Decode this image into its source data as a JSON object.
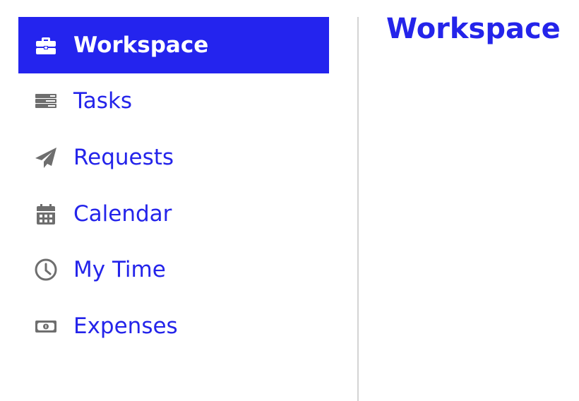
{
  "sidebar": {
    "items": [
      {
        "label": "Workspace",
        "icon": "toolbox-icon",
        "active": true
      },
      {
        "label": "Tasks",
        "icon": "tasks-icon",
        "active": false
      },
      {
        "label": "Requests",
        "icon": "paper-plane-icon",
        "active": false
      },
      {
        "label": "Calendar",
        "icon": "calendar-icon",
        "active": false
      },
      {
        "label": "My Time",
        "icon": "clock-icon",
        "active": false
      },
      {
        "label": "Expenses",
        "icon": "money-bill-icon",
        "active": false
      }
    ]
  },
  "main": {
    "title": "Workspace"
  },
  "colors": {
    "accent": "#2424ee",
    "icon_gray": "#6e6e6e",
    "divider": "#d4d4d4"
  }
}
